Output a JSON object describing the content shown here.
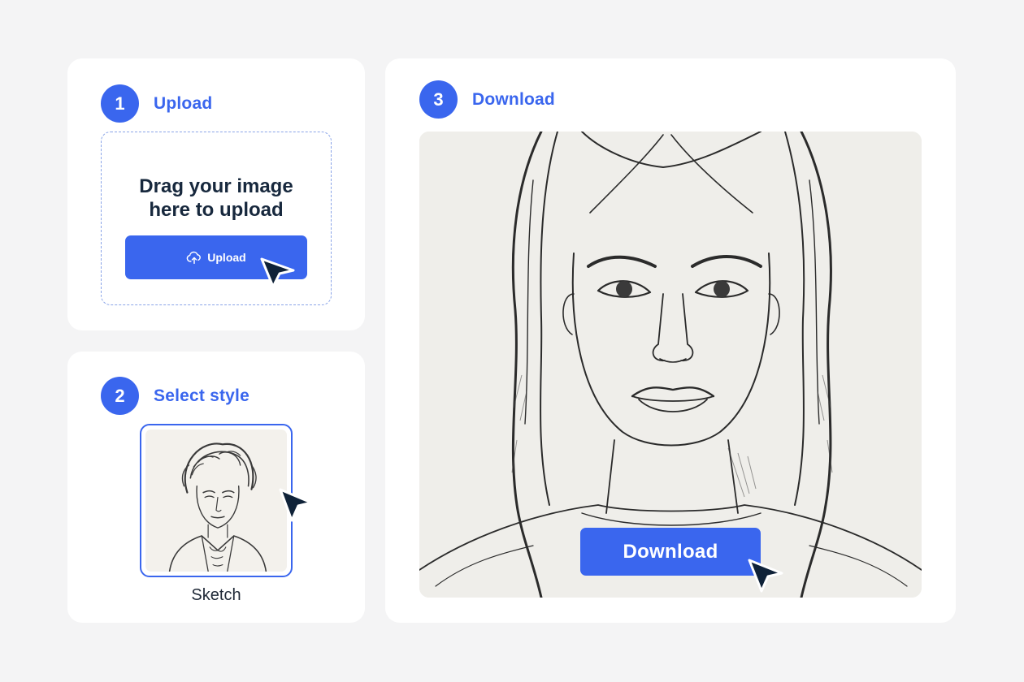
{
  "steps": {
    "upload": {
      "number": "1",
      "title": "Upload"
    },
    "style": {
      "number": "2",
      "title": "Select style"
    },
    "download": {
      "number": "3",
      "title": "Download"
    }
  },
  "upload": {
    "drop_text": "Drag  your image\nhere to upload",
    "button_label": "Upload",
    "button_icon": "cloud-upload-icon"
  },
  "style": {
    "selected_label": "Sketch"
  },
  "download": {
    "button_label": "Download"
  },
  "colors": {
    "accent": "#3a66ee",
    "background": "#f4f4f5",
    "card": "#ffffff",
    "text_dark": "#17283d",
    "cursor": "#0f2238"
  }
}
